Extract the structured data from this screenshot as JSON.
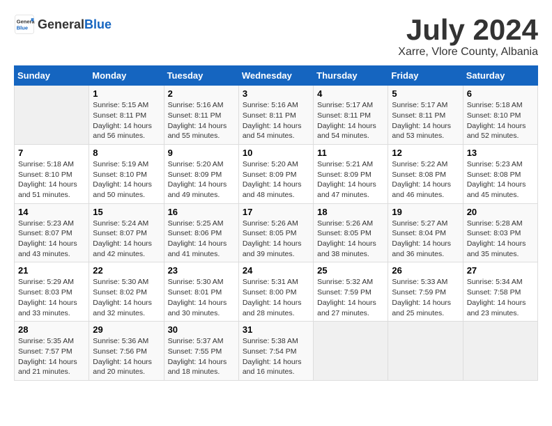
{
  "header": {
    "logo_general": "General",
    "logo_blue": "Blue",
    "title": "July 2024",
    "subtitle": "Xarre, Vlore County, Albania"
  },
  "calendar": {
    "days": [
      "Sunday",
      "Monday",
      "Tuesday",
      "Wednesday",
      "Thursday",
      "Friday",
      "Saturday"
    ],
    "weeks": [
      [
        {
          "date": "",
          "empty": true
        },
        {
          "date": "1",
          "sunrise": "5:15 AM",
          "sunset": "8:11 PM",
          "daylight": "14 hours and 56 minutes."
        },
        {
          "date": "2",
          "sunrise": "5:16 AM",
          "sunset": "8:11 PM",
          "daylight": "14 hours and 55 minutes."
        },
        {
          "date": "3",
          "sunrise": "5:16 AM",
          "sunset": "8:11 PM",
          "daylight": "14 hours and 54 minutes."
        },
        {
          "date": "4",
          "sunrise": "5:17 AM",
          "sunset": "8:11 PM",
          "daylight": "14 hours and 54 minutes."
        },
        {
          "date": "5",
          "sunrise": "5:17 AM",
          "sunset": "8:11 PM",
          "daylight": "14 hours and 53 minutes."
        },
        {
          "date": "6",
          "sunrise": "5:18 AM",
          "sunset": "8:10 PM",
          "daylight": "14 hours and 52 minutes."
        }
      ],
      [
        {
          "date": "7",
          "sunrise": "5:18 AM",
          "sunset": "8:10 PM",
          "daylight": "14 hours and 51 minutes."
        },
        {
          "date": "8",
          "sunrise": "5:19 AM",
          "sunset": "8:10 PM",
          "daylight": "14 hours and 50 minutes."
        },
        {
          "date": "9",
          "sunrise": "5:20 AM",
          "sunset": "8:09 PM",
          "daylight": "14 hours and 49 minutes."
        },
        {
          "date": "10",
          "sunrise": "5:20 AM",
          "sunset": "8:09 PM",
          "daylight": "14 hours and 48 minutes."
        },
        {
          "date": "11",
          "sunrise": "5:21 AM",
          "sunset": "8:09 PM",
          "daylight": "14 hours and 47 minutes."
        },
        {
          "date": "12",
          "sunrise": "5:22 AM",
          "sunset": "8:08 PM",
          "daylight": "14 hours and 46 minutes."
        },
        {
          "date": "13",
          "sunrise": "5:23 AM",
          "sunset": "8:08 PM",
          "daylight": "14 hours and 45 minutes."
        }
      ],
      [
        {
          "date": "14",
          "sunrise": "5:23 AM",
          "sunset": "8:07 PM",
          "daylight": "14 hours and 43 minutes."
        },
        {
          "date": "15",
          "sunrise": "5:24 AM",
          "sunset": "8:07 PM",
          "daylight": "14 hours and 42 minutes."
        },
        {
          "date": "16",
          "sunrise": "5:25 AM",
          "sunset": "8:06 PM",
          "daylight": "14 hours and 41 minutes."
        },
        {
          "date": "17",
          "sunrise": "5:26 AM",
          "sunset": "8:05 PM",
          "daylight": "14 hours and 39 minutes."
        },
        {
          "date": "18",
          "sunrise": "5:26 AM",
          "sunset": "8:05 PM",
          "daylight": "14 hours and 38 minutes."
        },
        {
          "date": "19",
          "sunrise": "5:27 AM",
          "sunset": "8:04 PM",
          "daylight": "14 hours and 36 minutes."
        },
        {
          "date": "20",
          "sunrise": "5:28 AM",
          "sunset": "8:03 PM",
          "daylight": "14 hours and 35 minutes."
        }
      ],
      [
        {
          "date": "21",
          "sunrise": "5:29 AM",
          "sunset": "8:03 PM",
          "daylight": "14 hours and 33 minutes."
        },
        {
          "date": "22",
          "sunrise": "5:30 AM",
          "sunset": "8:02 PM",
          "daylight": "14 hours and 32 minutes."
        },
        {
          "date": "23",
          "sunrise": "5:30 AM",
          "sunset": "8:01 PM",
          "daylight": "14 hours and 30 minutes."
        },
        {
          "date": "24",
          "sunrise": "5:31 AM",
          "sunset": "8:00 PM",
          "daylight": "14 hours and 28 minutes."
        },
        {
          "date": "25",
          "sunrise": "5:32 AM",
          "sunset": "7:59 PM",
          "daylight": "14 hours and 27 minutes."
        },
        {
          "date": "26",
          "sunrise": "5:33 AM",
          "sunset": "7:59 PM",
          "daylight": "14 hours and 25 minutes."
        },
        {
          "date": "27",
          "sunrise": "5:34 AM",
          "sunset": "7:58 PM",
          "daylight": "14 hours and 23 minutes."
        }
      ],
      [
        {
          "date": "28",
          "sunrise": "5:35 AM",
          "sunset": "7:57 PM",
          "daylight": "14 hours and 21 minutes."
        },
        {
          "date": "29",
          "sunrise": "5:36 AM",
          "sunset": "7:56 PM",
          "daylight": "14 hours and 20 minutes."
        },
        {
          "date": "30",
          "sunrise": "5:37 AM",
          "sunset": "7:55 PM",
          "daylight": "14 hours and 18 minutes."
        },
        {
          "date": "31",
          "sunrise": "5:38 AM",
          "sunset": "7:54 PM",
          "daylight": "14 hours and 16 minutes."
        },
        {
          "date": "",
          "empty": true
        },
        {
          "date": "",
          "empty": true
        },
        {
          "date": "",
          "empty": true
        }
      ]
    ]
  }
}
